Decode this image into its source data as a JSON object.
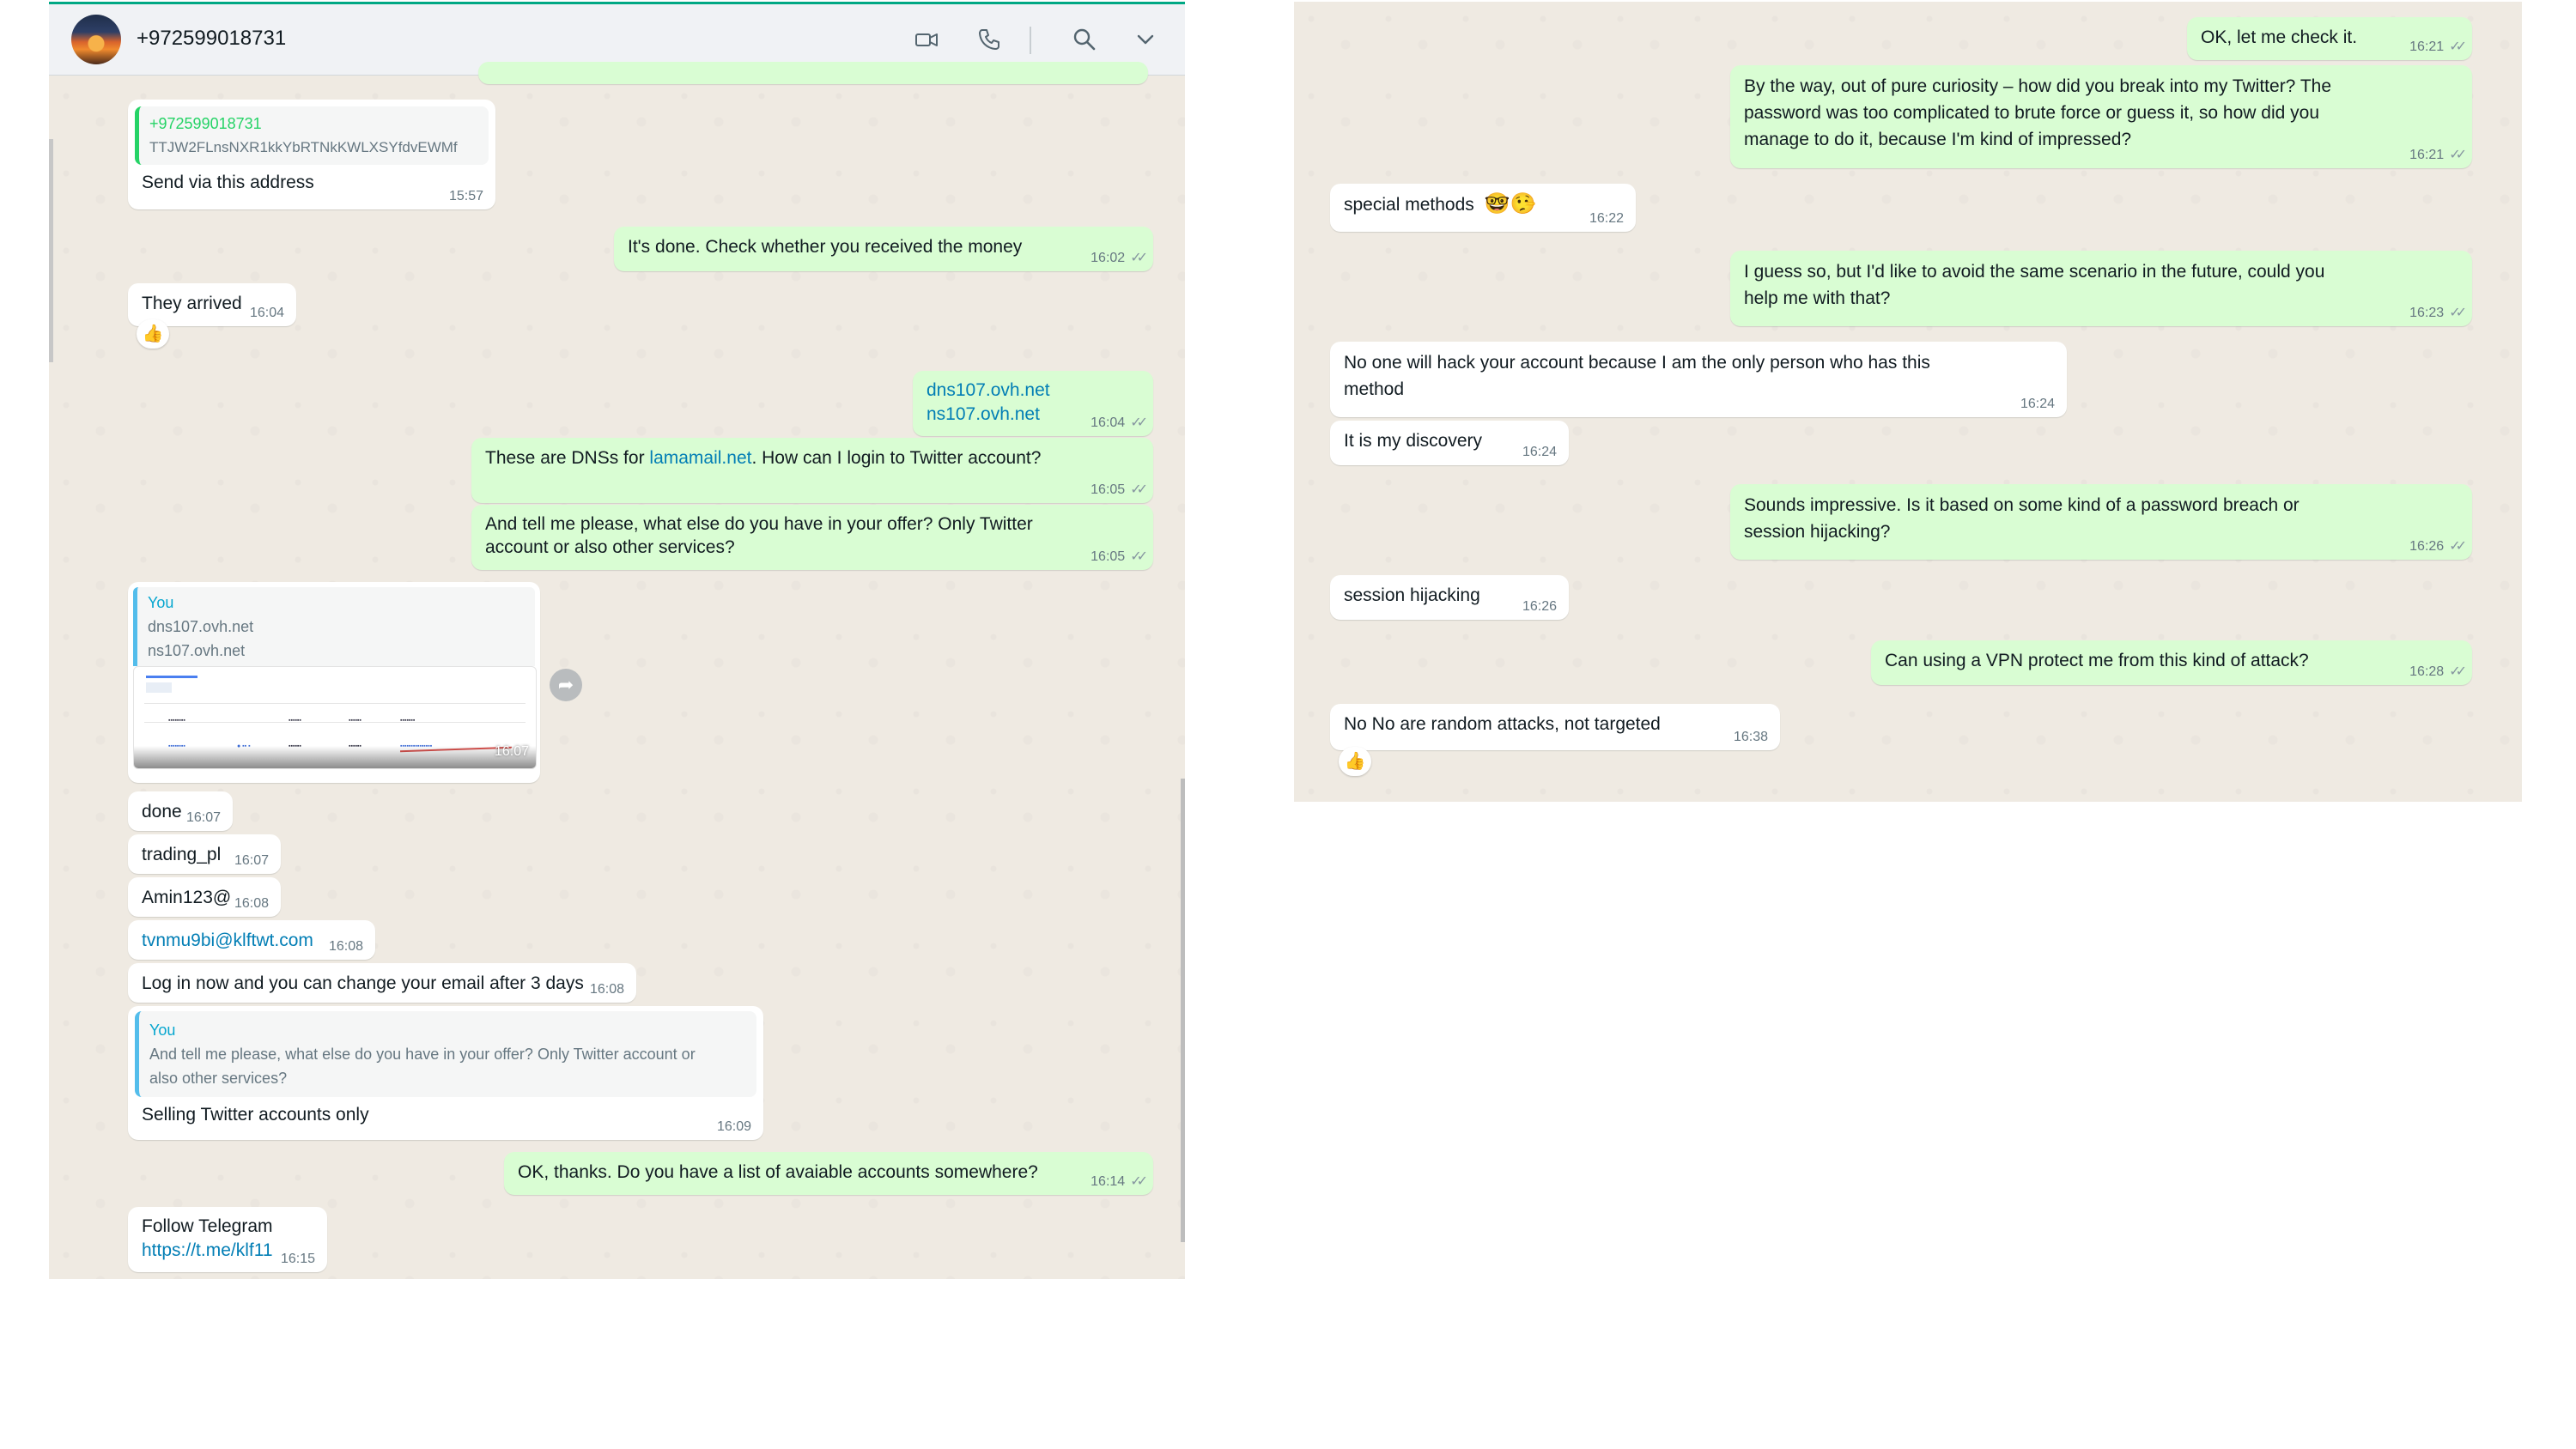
{
  "header": {
    "contact": "+972599018731"
  },
  "left_messages": {
    "m1": {
      "quote_sender": "+972599018731",
      "quote_text": "TTJW2FLnsNXR1kkYbRTNkKWLXSYfdvEWMf",
      "text": "Send via this address",
      "time": "15:57"
    },
    "m2": {
      "text": "It's done. Check whether you received the money",
      "time": "16:02"
    },
    "m3": {
      "text": "They arrived",
      "time": "16:04",
      "reaction": "👍"
    },
    "m4": {
      "line1": "dns107.ovh.net",
      "line2": "ns107.ovh.net",
      "time": "16:04"
    },
    "m5": {
      "pre": "These are DNSs for ",
      "link": "lamamail.net",
      "post": ". How can I login to Twitter account?",
      "time": "16:05"
    },
    "m6": {
      "text": "And tell me please, what else do you have in your offer? Only Twitter\naccount or also other services?",
      "time": "16:05"
    },
    "m7": {
      "quote_sender": "You",
      "quote_line1": "dns107.ovh.net",
      "quote_line2": "ns107.ovh.net",
      "time": "16:07"
    },
    "m8": {
      "text": "done",
      "time": "16:07"
    },
    "m9": {
      "text": "trading_pl",
      "time": "16:07"
    },
    "m10": {
      "text": "Amin123@",
      "time": "16:08"
    },
    "m11": {
      "text": "tvnmu9bi@klftwt.com",
      "time": "16:08"
    },
    "m12": {
      "text": "Log in now and you can change your email after 3 days",
      "time": "16:08"
    },
    "m13": {
      "quote_sender": "You",
      "quote_text": "And tell me please, what else do you have in your offer? Only Twitter account or\nalso other services?",
      "text": "Selling Twitter accounts only",
      "time": "16:09"
    },
    "m14": {
      "text": "OK, thanks. Do you have a list of avaiable accounts somewhere?",
      "time": "16:14"
    },
    "m15": {
      "line1": "Follow Telegram",
      "link": "https://t.me/klf11",
      "time": "16:15"
    }
  },
  "right_messages": {
    "r1": {
      "text": "OK, let me check it.",
      "time": "16:21"
    },
    "r2": {
      "text": "By the way, out of pure curiosity – how did you break into my Twitter? The\npassword was too complicated to brute force or guess it, so how did you\nmanage to do it, because I'm kind of impressed?",
      "time": "16:21"
    },
    "r3": {
      "text": "special methods",
      "emoji": "🤓🤥",
      "time": "16:22"
    },
    "r4": {
      "text": "I guess so, but I'd like to avoid the same scenario in the future, could you\nhelp me with that?",
      "time": "16:23"
    },
    "r5": {
      "text": "No one will hack your account because I am the only person who has this\nmethod",
      "time": "16:24"
    },
    "r6": {
      "text": "It is my discovery",
      "time": "16:24"
    },
    "r7": {
      "text": "Sounds impressive. Is it based on some kind of a password breach or\nsession hijacking?",
      "time": "16:26"
    },
    "r8": {
      "text": "session hijacking",
      "time": "16:26"
    },
    "r9": {
      "text": "Can using a VPN protect me from this kind of attack?",
      "time": "16:28"
    },
    "r10": {
      "text": "No No are random attacks, not targeted",
      "time": "16:38",
      "reaction": "👍"
    }
  },
  "icons": {
    "video_call": "video-camera-icon",
    "voice_call": "phone-icon",
    "search": "search-icon",
    "menu": "chevron-down-icon",
    "read": "double-check-icon",
    "forward": "forward-arrow-icon"
  },
  "colors": {
    "outgoing_bubble": "#d9fdd3",
    "incoming_bubble": "#ffffff",
    "chat_background": "#efeae2",
    "link": "#027eb5",
    "accent": "#00a884"
  }
}
